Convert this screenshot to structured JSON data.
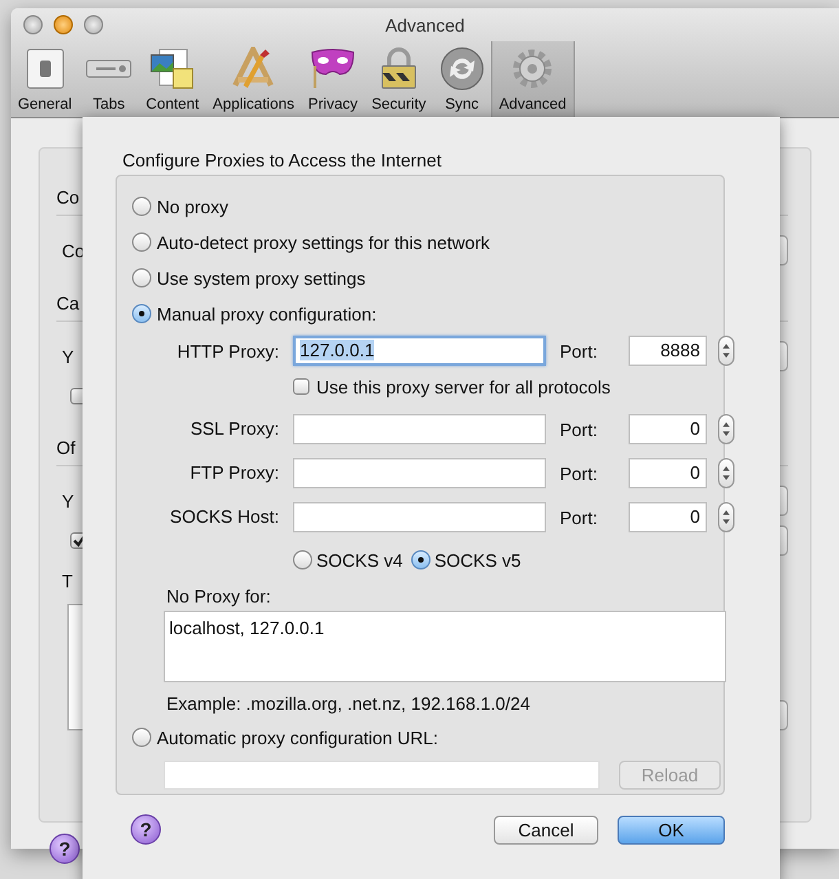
{
  "window": {
    "title": "Advanced"
  },
  "toolbar": [
    {
      "label": "General",
      "selected": false
    },
    {
      "label": "Tabs",
      "selected": false
    },
    {
      "label": "Content",
      "selected": false
    },
    {
      "label": "Applications",
      "selected": false
    },
    {
      "label": "Privacy",
      "selected": false
    },
    {
      "label": "Security",
      "selected": false
    },
    {
      "label": "Sync",
      "selected": false
    },
    {
      "label": "Advanced",
      "selected": true
    }
  ],
  "background": {
    "rows": [
      {
        "kind": "header",
        "text": "Co"
      },
      {
        "kind": "text",
        "text": "Co",
        "button": true
      },
      {
        "kind": "header",
        "text": "Ca"
      },
      {
        "kind": "text",
        "text": "Y",
        "button": true
      },
      {
        "kind": "checkbox",
        "checked": false,
        "button": false
      },
      {
        "kind": "header",
        "text": "Of"
      },
      {
        "kind": "text",
        "text": "Y",
        "button": true
      },
      {
        "kind": "checkbox",
        "checked": true,
        "button": true
      },
      {
        "kind": "text",
        "text": "T",
        "button": false
      },
      {
        "kind": "textarea",
        "button": true
      }
    ],
    "help": "?"
  },
  "dialog": {
    "title": "Configure Proxies to Access the Internet",
    "modes": [
      {
        "label": "No proxy",
        "selected": false
      },
      {
        "label": "Auto-detect proxy settings for this network",
        "selected": false
      },
      {
        "label": "Use system proxy settings",
        "selected": false
      },
      {
        "label": "Manual proxy configuration:",
        "selected": true
      }
    ],
    "http": {
      "label": "HTTP Proxy:",
      "value": "127.0.0.1",
      "text_selected": true,
      "port_label": "Port:",
      "port": "8888"
    },
    "same_proxy": {
      "label": "Use this proxy server for all protocols",
      "checked": false
    },
    "proxies": [
      {
        "label": "SSL Proxy:",
        "port_label": "Port:",
        "port": "0"
      },
      {
        "label": "FTP Proxy:",
        "port_label": "Port:",
        "port": "0"
      },
      {
        "label": "SOCKS Host:",
        "port_label": "Port:",
        "port": "0"
      }
    ],
    "socks_versions": [
      {
        "label": "SOCKS v4",
        "selected": false
      },
      {
        "label": "SOCKS v5",
        "selected": true
      }
    ],
    "no_proxy_label": "No Proxy for:",
    "no_proxy": "localhost, 127.0.0.1",
    "example": "Example: .mozilla.org, .net.nz, 192.168.1.0/24",
    "auto_url": {
      "label": "Automatic proxy configuration URL:",
      "selected": false
    },
    "reload": {
      "label": "Reload",
      "disabled": true
    },
    "help": "?",
    "buttons": [
      {
        "label": "Cancel",
        "default": false
      },
      {
        "label": "OK",
        "default": true
      }
    ]
  }
}
